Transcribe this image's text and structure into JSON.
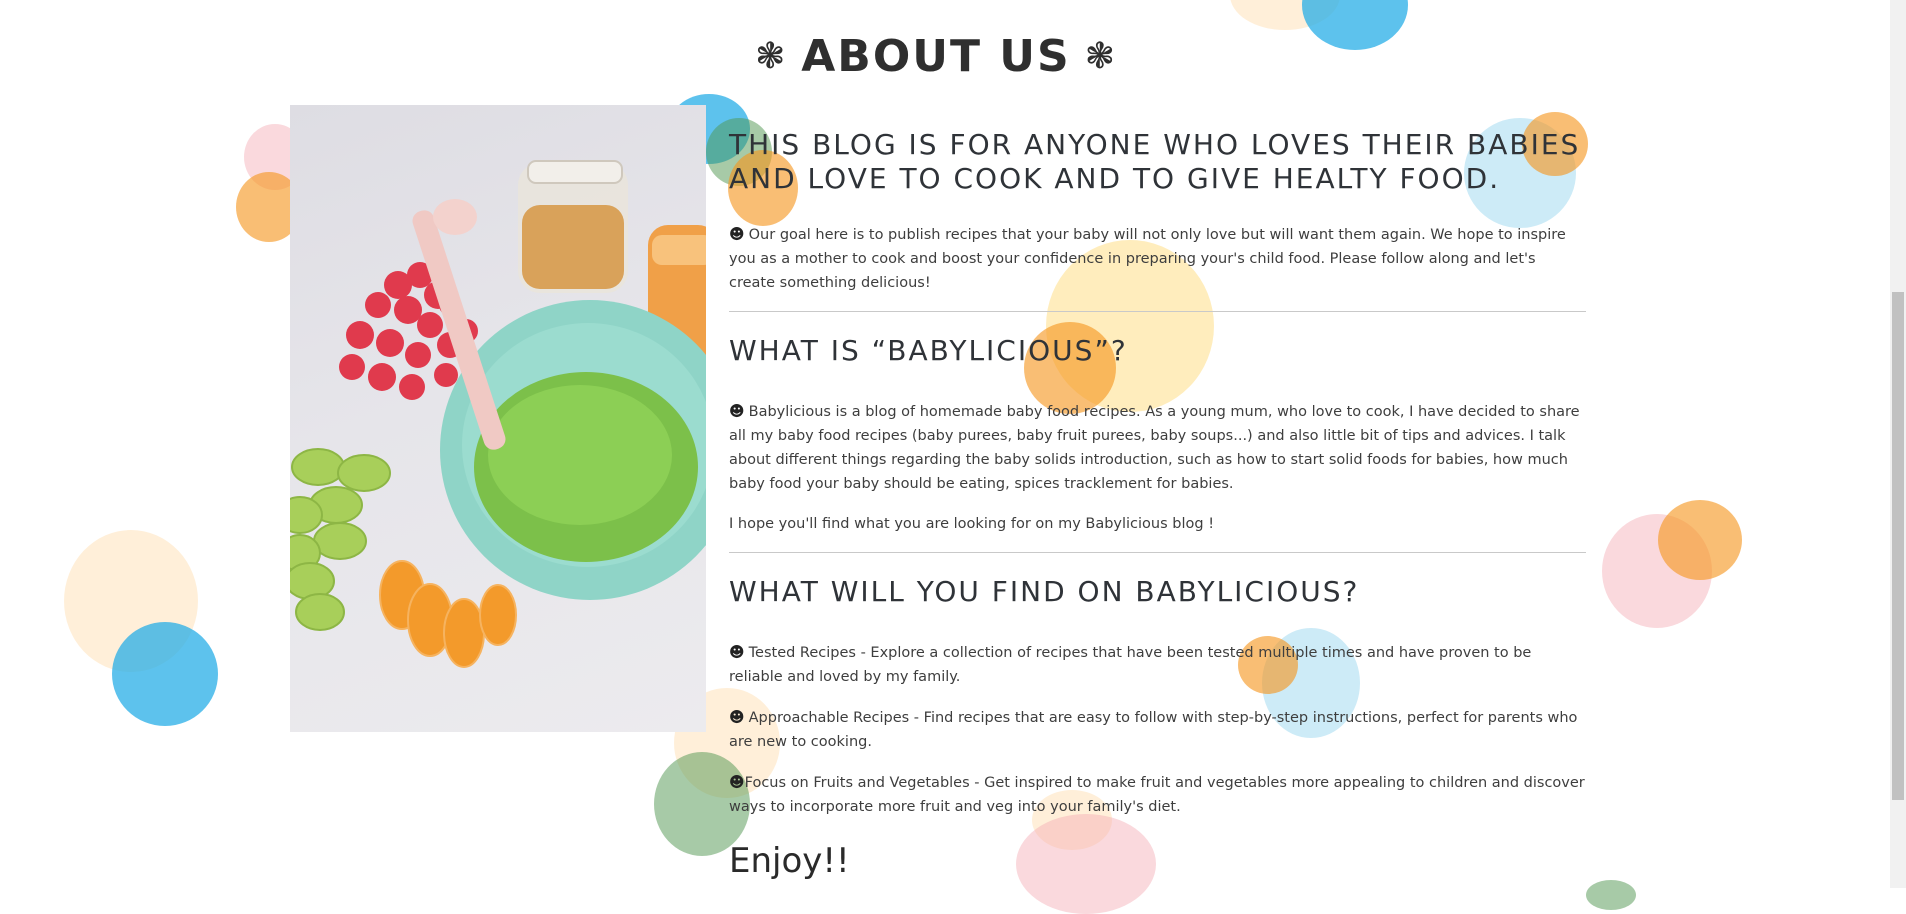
{
  "page_title": "ABOUT US",
  "title_ornament": "❃",
  "smiley": "☻",
  "image": {
    "alt": "Bowl of green baby food puree with raspberries, grapes, mandarin and jars"
  },
  "sections": {
    "intro": {
      "heading": "THIS BLOG IS FOR ANYONE WHO LOVES THEIR BABIES AND LOVE TO COOK AND TO GIVE HEALTY FOOD.",
      "text": "Our goal here is to publish recipes that your baby will not only love but will want them again. We hope to inspire you as a mother to cook and boost your confidence in preparing your's child food. Please follow along and let's create something delicious!"
    },
    "what_is": {
      "heading": "WHAT IS “BABYLICIOUS”?",
      "text": "Babylicious is a blog of homemade baby food recipes. As a young mum, who love to cook, I have decided to share all my baby food recipes (baby purees, baby fruit purees, baby soups...) and also little bit of tips and advices. I talk about different things regarding the baby solids introduction, such as how to start solid foods for babies, how much baby food your baby should be eating, spices tracklement for babies.",
      "text2": "I hope you'll find what you are looking for on my Babylicious blog !"
    },
    "find": {
      "heading": "WHAT WILL YOU FIND ON BABYLICIOUS?",
      "items": [
        "Tested Recipes - Explore a collection of recipes that have been tested multiple times and have proven to be reliable and loved by my family.",
        "Approachable Recipes - Find recipes that are easy to follow with step-by-step instructions, perfect for parents who are new to cooking.",
        "Focus on Fruits and Vegetables - Get inspired to make fruit and vegetables more appealing to children and discover ways to incorporate more fruit and veg into your family's diet."
      ]
    }
  },
  "closing": "Enjoy!!",
  "colors": {
    "text": "#3e3e3e",
    "heading": "#2f3338",
    "background": "#ffffff"
  }
}
